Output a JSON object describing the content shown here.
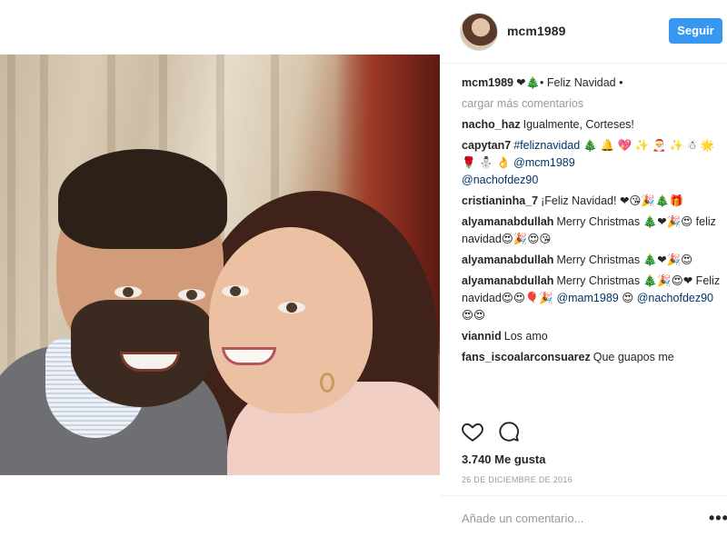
{
  "post": {
    "username": "mcm1989",
    "follow_label": "Seguir",
    "caption_text": "❤🎄• Feliz Navidad •",
    "load_more": "cargar más comentarios",
    "comments": [
      {
        "user": "nacho_haz",
        "text": "Igualmente, Corteses!"
      },
      {
        "user": "capytan7",
        "tag1": "#feliznavidad",
        "text": " 🎄 🔔 💖 ✨ 🎅 ✨ ☃ 🌟 🌹 ⛄ 👌 ",
        "tag2": "@mcm1989",
        "tag3": "@nachofdez90"
      },
      {
        "user": "cristianinha_7",
        "text": "¡Feliz Navidad! ❤😘🎉🎄🎁"
      },
      {
        "user": "alyamanabdullah",
        "text": "Merry Christmas 🎄❤🎉😍 feliz navidad😍🎉😍😘"
      },
      {
        "user": "alyamanabdullah",
        "text": "Merry Christmas 🎄❤🎉😍"
      },
      {
        "user": "alyamanabdullah",
        "text": "Merry Christmas 🎄🎉😍❤ Feliz navidad😍😍🎈🎉 ",
        "tag2": "@mam1989",
        "text2": " 😍 ",
        "tag3": "@nachofdez90",
        "text3": "😍😍"
      },
      {
        "user": "viannid",
        "text": "Los amo"
      },
      {
        "user": "fans_iscoalarconsuarez",
        "text": "Que guapos me"
      }
    ],
    "likes_text": "3.740 Me gusta",
    "date_text": "26 DE DICIEMBRE DE 2016",
    "comment_placeholder": "Añade un comentario...",
    "more_label": "•••"
  },
  "icons": {
    "like": "heart-icon",
    "comment": "comment-icon",
    "more": "more-options-icon"
  },
  "colors": {
    "accent": "#3897f0",
    "text": "#262626",
    "muted": "#999999",
    "link": "#003569"
  }
}
